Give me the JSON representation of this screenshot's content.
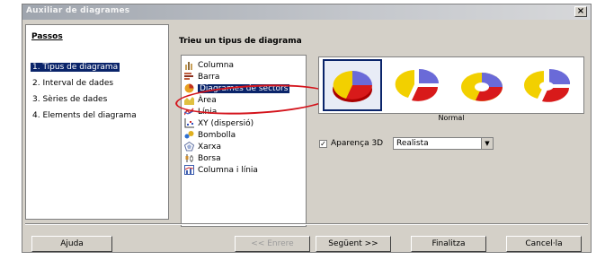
{
  "window": {
    "title": "Auxiliar de diagrames",
    "close_label": "×"
  },
  "steps": {
    "title": "Passos",
    "items": [
      {
        "label": "1. Tipus de diagrama",
        "selected": true
      },
      {
        "label": "2. Interval de dades",
        "selected": false
      },
      {
        "label": "3. Sèries de dades",
        "selected": false
      },
      {
        "label": "4. Elements del diagrama",
        "selected": false
      }
    ]
  },
  "main": {
    "heading": "Trieu un tipus de diagrama",
    "types": [
      {
        "label": "Columna",
        "icon": "column-chart-icon",
        "color": "#c8a05a"
      },
      {
        "label": "Barra",
        "icon": "bar-chart-icon",
        "color": "#c06040"
      },
      {
        "label": "Diagrames de sectors",
        "icon": "pie-chart-icon",
        "color": "#e8a020",
        "selected": true
      },
      {
        "label": "Àrea",
        "icon": "area-chart-icon",
        "color": "#e0c040"
      },
      {
        "label": "Línia",
        "icon": "line-chart-icon",
        "color": "#d03030"
      },
      {
        "label": "XY (dispersió)",
        "icon": "scatter-chart-icon",
        "color": "#3050c0"
      },
      {
        "label": "Bombolla",
        "icon": "bubble-chart-icon",
        "color": "#3070d0"
      },
      {
        "label": "Xarxa",
        "icon": "net-chart-icon",
        "color": "#6070a0"
      },
      {
        "label": "Borsa",
        "icon": "stock-chart-icon",
        "color": "#d09030"
      },
      {
        "label": "Columna i línia",
        "icon": "column-line-chart-icon",
        "color": "#4060b0"
      }
    ],
    "variants": [
      {
        "name": "normal-pie-thumb",
        "selected": true
      },
      {
        "name": "exploded-pie-thumb",
        "selected": false
      },
      {
        "name": "donut-pie-thumb",
        "selected": false
      },
      {
        "name": "exploded-donut-thumb",
        "selected": false
      }
    ],
    "variant_label": "Normal",
    "appearance_3d_label": "Aparença 3D",
    "appearance_3d_checked": true,
    "appearance_3d_value": "Realista"
  },
  "buttons": {
    "help": "Ajuda",
    "back": "<< Enrere",
    "next": "Següent >>",
    "finish": "Finalitza",
    "cancel": "Cancel·la"
  },
  "colors": {
    "highlight": "#0a246a",
    "annotation": "#d4141c",
    "pie_yellow": "#f2d000",
    "pie_red": "#d81a1a",
    "pie_blue": "#6a6ad8"
  }
}
